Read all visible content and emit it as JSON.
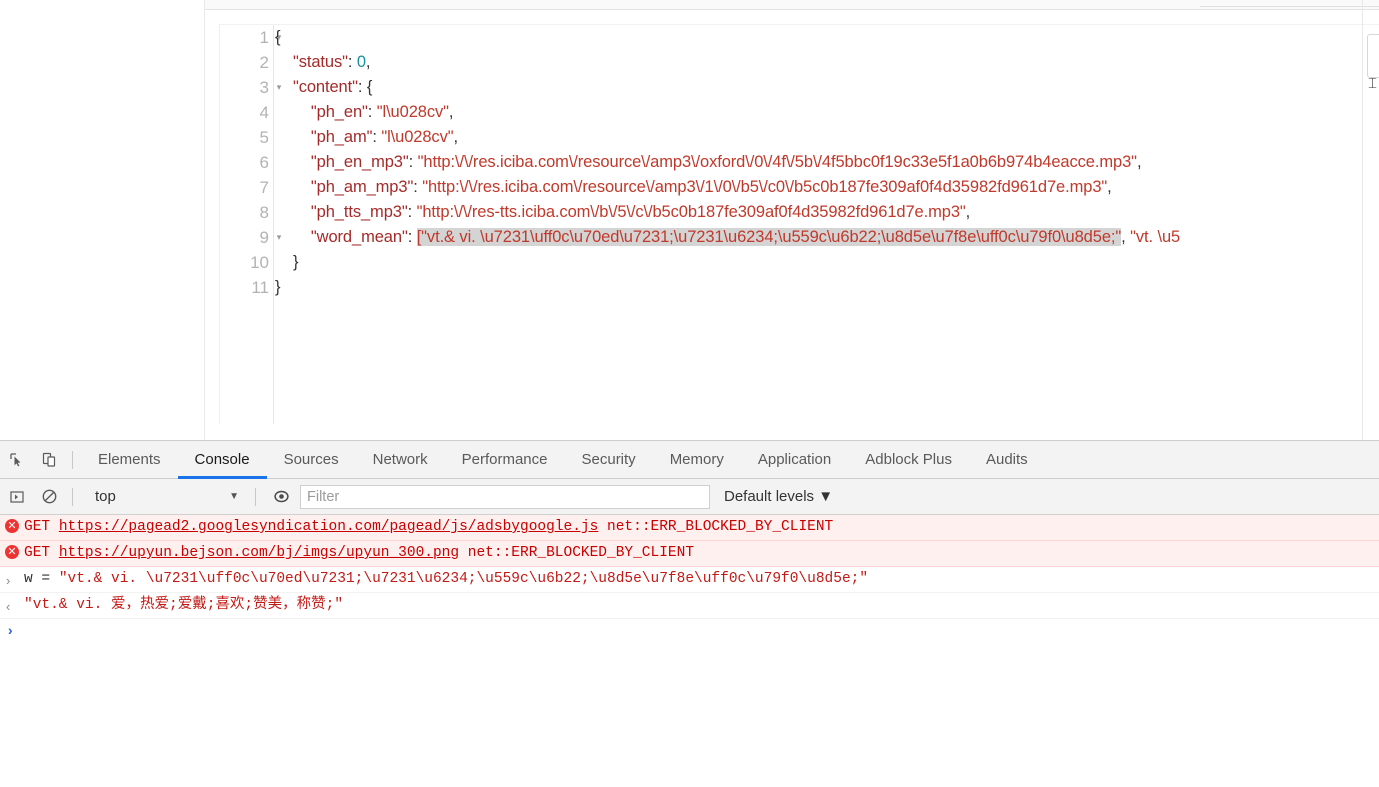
{
  "json_viewer": {
    "lines": [
      {
        "num": "1",
        "fold": true,
        "indent": 0,
        "tokens": [
          {
            "t": "{",
            "c": "jbrace"
          }
        ]
      },
      {
        "num": "2",
        "fold": false,
        "indent": 1,
        "tokens": [
          {
            "t": "\"status\"",
            "c": "jkey"
          },
          {
            "t": ": ",
            "c": "jpunc"
          },
          {
            "t": "0",
            "c": "jnum"
          },
          {
            "t": ",",
            "c": "jpunc"
          }
        ]
      },
      {
        "num": "3",
        "fold": true,
        "indent": 1,
        "tokens": [
          {
            "t": "\"content\"",
            "c": "jkey"
          },
          {
            "t": ": {",
            "c": "jpunc"
          }
        ]
      },
      {
        "num": "4",
        "fold": false,
        "indent": 2,
        "tokens": [
          {
            "t": "\"ph_en\"",
            "c": "jkey"
          },
          {
            "t": ": ",
            "c": "jpunc"
          },
          {
            "t": "\"l\\u028cv\"",
            "c": "jstr"
          },
          {
            "t": ",",
            "c": "jpunc"
          }
        ]
      },
      {
        "num": "5",
        "fold": false,
        "indent": 2,
        "tokens": [
          {
            "t": "\"ph_am\"",
            "c": "jkey"
          },
          {
            "t": ": ",
            "c": "jpunc"
          },
          {
            "t": "\"l\\u028cv\"",
            "c": "jstr"
          },
          {
            "t": ",",
            "c": "jpunc"
          }
        ]
      },
      {
        "num": "6",
        "fold": false,
        "indent": 2,
        "tokens": [
          {
            "t": "\"ph_en_mp3\"",
            "c": "jkey"
          },
          {
            "t": ": ",
            "c": "jpunc"
          },
          {
            "t": "\"http:\\/\\/res.iciba.com\\/resource\\/amp3\\/oxford\\/0\\/4f\\/5b\\/4f5bbc0f19c33e5f1a0b6b974b4eacce.mp3\"",
            "c": "jstr"
          },
          {
            "t": ",",
            "c": "jpunc"
          }
        ]
      },
      {
        "num": "7",
        "fold": false,
        "indent": 2,
        "tokens": [
          {
            "t": "\"ph_am_mp3\"",
            "c": "jkey"
          },
          {
            "t": ": ",
            "c": "jpunc"
          },
          {
            "t": "\"http:\\/\\/res.iciba.com\\/resource\\/amp3\\/1\\/0\\/b5\\/c0\\/b5c0b187fe309af0f4d35982fd961d7e.mp3\"",
            "c": "jstr"
          },
          {
            "t": ",",
            "c": "jpunc"
          }
        ]
      },
      {
        "num": "8",
        "fold": false,
        "indent": 2,
        "tokens": [
          {
            "t": "\"ph_tts_mp3\"",
            "c": "jkey"
          },
          {
            "t": ": ",
            "c": "jpunc"
          },
          {
            "t": "\"http:\\/\\/res-tts.iciba.com\\/b\\/5\\/c\\/b5c0b187fe309af0f4d35982fd961d7e.mp3\"",
            "c": "jstr"
          },
          {
            "t": ",",
            "c": "jpunc"
          }
        ]
      },
      {
        "num": "9",
        "fold": true,
        "indent": 2,
        "tokens": [
          {
            "t": "\"word_mean\"",
            "c": "jkey"
          },
          {
            "t": ": ",
            "c": "jpunc"
          },
          {
            "t": "[\"vt.& vi. \\u7231\\uff0c\\u70ed\\u7231;\\u7231\\u6234;\\u559c\\u6b22;\\u8d5e\\u7f8e\\uff0c\\u79f0\\u8d5e;\"",
            "c": "jstr hl"
          },
          {
            "t": ", ",
            "c": "jpunc"
          },
          {
            "t": "\"vt. \\u5",
            "c": "jstr"
          }
        ]
      },
      {
        "num": "10",
        "fold": false,
        "indent": 1,
        "tokens": [
          {
            "t": "}",
            "c": "jbrace"
          }
        ]
      },
      {
        "num": "11",
        "fold": false,
        "indent": 0,
        "tokens": [
          {
            "t": "}",
            "c": "jbrace"
          }
        ]
      }
    ]
  },
  "devtools": {
    "toolbar_icons": [
      {
        "name": "inspect-element-icon",
        "title": "Inspect element"
      },
      {
        "name": "device-toolbar-icon",
        "title": "Toggle device toolbar"
      }
    ],
    "tabs": [
      {
        "label": "Elements",
        "active": false
      },
      {
        "label": "Console",
        "active": true
      },
      {
        "label": "Sources",
        "active": false
      },
      {
        "label": "Network",
        "active": false
      },
      {
        "label": "Performance",
        "active": false
      },
      {
        "label": "Security",
        "active": false
      },
      {
        "label": "Memory",
        "active": false
      },
      {
        "label": "Application",
        "active": false
      },
      {
        "label": "Adblock Plus",
        "active": false
      },
      {
        "label": "Audits",
        "active": false
      }
    ],
    "console_toolbar": {
      "sidebar_toggle_icon": "console-sidebar-icon",
      "clear_icon": "clear-console-icon",
      "context_value": "top",
      "context_caret": "▼",
      "eye_icon": "live-expression-icon",
      "filter_placeholder": "Filter",
      "filter_value": "",
      "levels_label": "Default levels",
      "levels_caret": "▼"
    },
    "messages": [
      {
        "type": "error",
        "badge": "✕",
        "method": "GET",
        "url": "https://pagead2.googlesyndication.com/pagead/js/adsbygoogle.js",
        "status": "net::ERR_BLOCKED_BY_CLIENT"
      },
      {
        "type": "error",
        "badge": "✕",
        "method": "GET",
        "url": "https://upyun.bejson.com/bj/imgs/upyun_300.png",
        "status": "net::ERR_BLOCKED_BY_CLIENT"
      },
      {
        "type": "input",
        "arrow": "›",
        "text": "w =  \"vt.& vi. \\u7231\\uff0c\\u70ed\\u7231;\\u7231\\u6234;\\u559c\\u6b22;\\u8d5e\\u7f8e\\uff0c\\u79f0\\u8d5e;\""
      },
      {
        "type": "output",
        "arrow": "‹",
        "text": "\"vt.& vi. 爱，热爱;爱戴;喜欢;赞美，称赞;\""
      }
    ],
    "prompt": {
      "arrow": "›",
      "value": ""
    }
  },
  "colors": {
    "accent_blue": "#1a73e8",
    "error_red": "#d60000",
    "json_key": "#a52a2a",
    "json_string": "#c0392b",
    "json_number": "#1a8fa0",
    "highlight": "#d4d4d4"
  }
}
